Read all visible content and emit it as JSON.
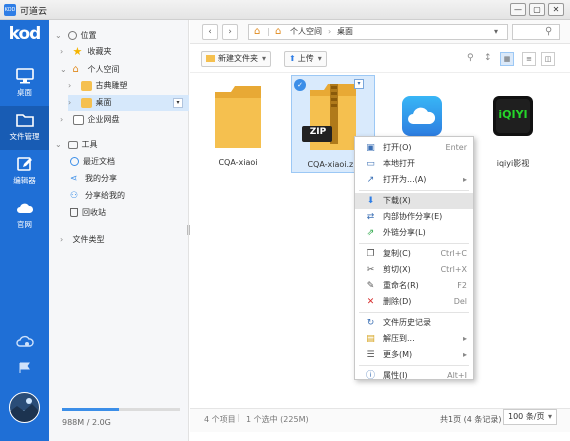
{
  "window": {
    "title": "可道云",
    "app_icon_text": "KOD",
    "minimize": "—",
    "maximize": "▢",
    "close": "✕"
  },
  "nav": {
    "logo": "kod",
    "items": [
      {
        "name": "desktop",
        "label": "桌面"
      },
      {
        "name": "file-manager",
        "label": "文件管理"
      },
      {
        "name": "editor",
        "label": "编辑器"
      },
      {
        "name": "official-site",
        "label": "官网"
      }
    ]
  },
  "sidebar": {
    "locations_title": "位置",
    "favorites": "收藏夹",
    "personal_space": "个人空间",
    "classic_music": "古典雕塑",
    "desktop": "桌面",
    "enterprise_disk": "企业网盘",
    "tools_title": "工具",
    "recent_docs": "最近文档",
    "my_shares": "我的分享",
    "shared_to_me": "分享给我的",
    "recycle_bin": "回收站",
    "file_types": "文件类型",
    "usage_text": "988M / 2.0G",
    "usage_fraction": 0.48
  },
  "toolbar": {
    "back": "‹",
    "forward": "›",
    "breadcrumb_root": "个人空间",
    "breadcrumb_sep": "›",
    "breadcrumb_current": "桌面",
    "path_dropdown": "▾",
    "search_icon": "⚲",
    "new_folder": "新建文件夹",
    "upload": "上传",
    "zoom": "⚲",
    "sort": "↕",
    "view_icon": "▦",
    "view_list": "≡",
    "view_split": "◫",
    "dropdown": "▾"
  },
  "files": [
    {
      "name": "CQA-xiaoi",
      "type": "folder"
    },
    {
      "name": "CQA-xiaoi.zip",
      "type": "zip",
      "badge": "ZIP"
    },
    {
      "name": "",
      "type": "icloud"
    },
    {
      "name": "iqiyi影视",
      "type": "iqiyi",
      "logo": "iQIYI"
    }
  ],
  "context_menu": {
    "items": [
      {
        "label": "打开(O)",
        "key": "Enter",
        "icon": "▣",
        "color": "#3b6fb4"
      },
      {
        "label": "本地打开",
        "key": "",
        "icon": "▭",
        "color": "#3b6fb4"
      },
      {
        "label": "打开为...(A)",
        "key": "▸",
        "icon": "↗",
        "color": "#3b6fb4"
      },
      {
        "label": "下载(X)",
        "key": "",
        "icon": "⬇",
        "color": "#2f7ee6"
      },
      {
        "label": "内部协作分享(E)",
        "key": "",
        "icon": "⇄",
        "color": "#3b6fb4"
      },
      {
        "label": "外链分享(L)",
        "key": "",
        "icon": "⇗",
        "color": "#2ea84a"
      },
      {
        "label": "复制(C)",
        "key": "Ctrl+C",
        "icon": "❐",
        "color": "#555555"
      },
      {
        "label": "剪切(X)",
        "key": "Ctrl+X",
        "icon": "✂",
        "color": "#555555"
      },
      {
        "label": "重命名(R)",
        "key": "F2",
        "icon": "✎",
        "color": "#555555"
      },
      {
        "label": "删除(D)",
        "key": "Del",
        "icon": "✕",
        "color": "#d62b2b"
      },
      {
        "label": "文件历史记录",
        "key": "",
        "icon": "↻",
        "color": "#3b6fb4"
      },
      {
        "label": "解压到...",
        "key": "▸",
        "icon": "▤",
        "color": "#d4a017"
      },
      {
        "label": "更多(M)",
        "key": "▸",
        "icon": "☰",
        "color": "#555555"
      },
      {
        "label": "属性(I)",
        "key": "Alt+I",
        "icon": "ⓘ",
        "color": "#3b6fb4"
      }
    ]
  },
  "status": {
    "count": "4 个项目",
    "selected": "1 个选中 (225M)",
    "page": "共1页 (4 条记录)",
    "per_page": "100 条/页"
  },
  "colors": {
    "accent": "#2f7ee6",
    "nav_bg": "#1f6fd6",
    "nav_active": "#185cb4",
    "folder": "#f5c04f",
    "selection": "#d9eafc"
  }
}
